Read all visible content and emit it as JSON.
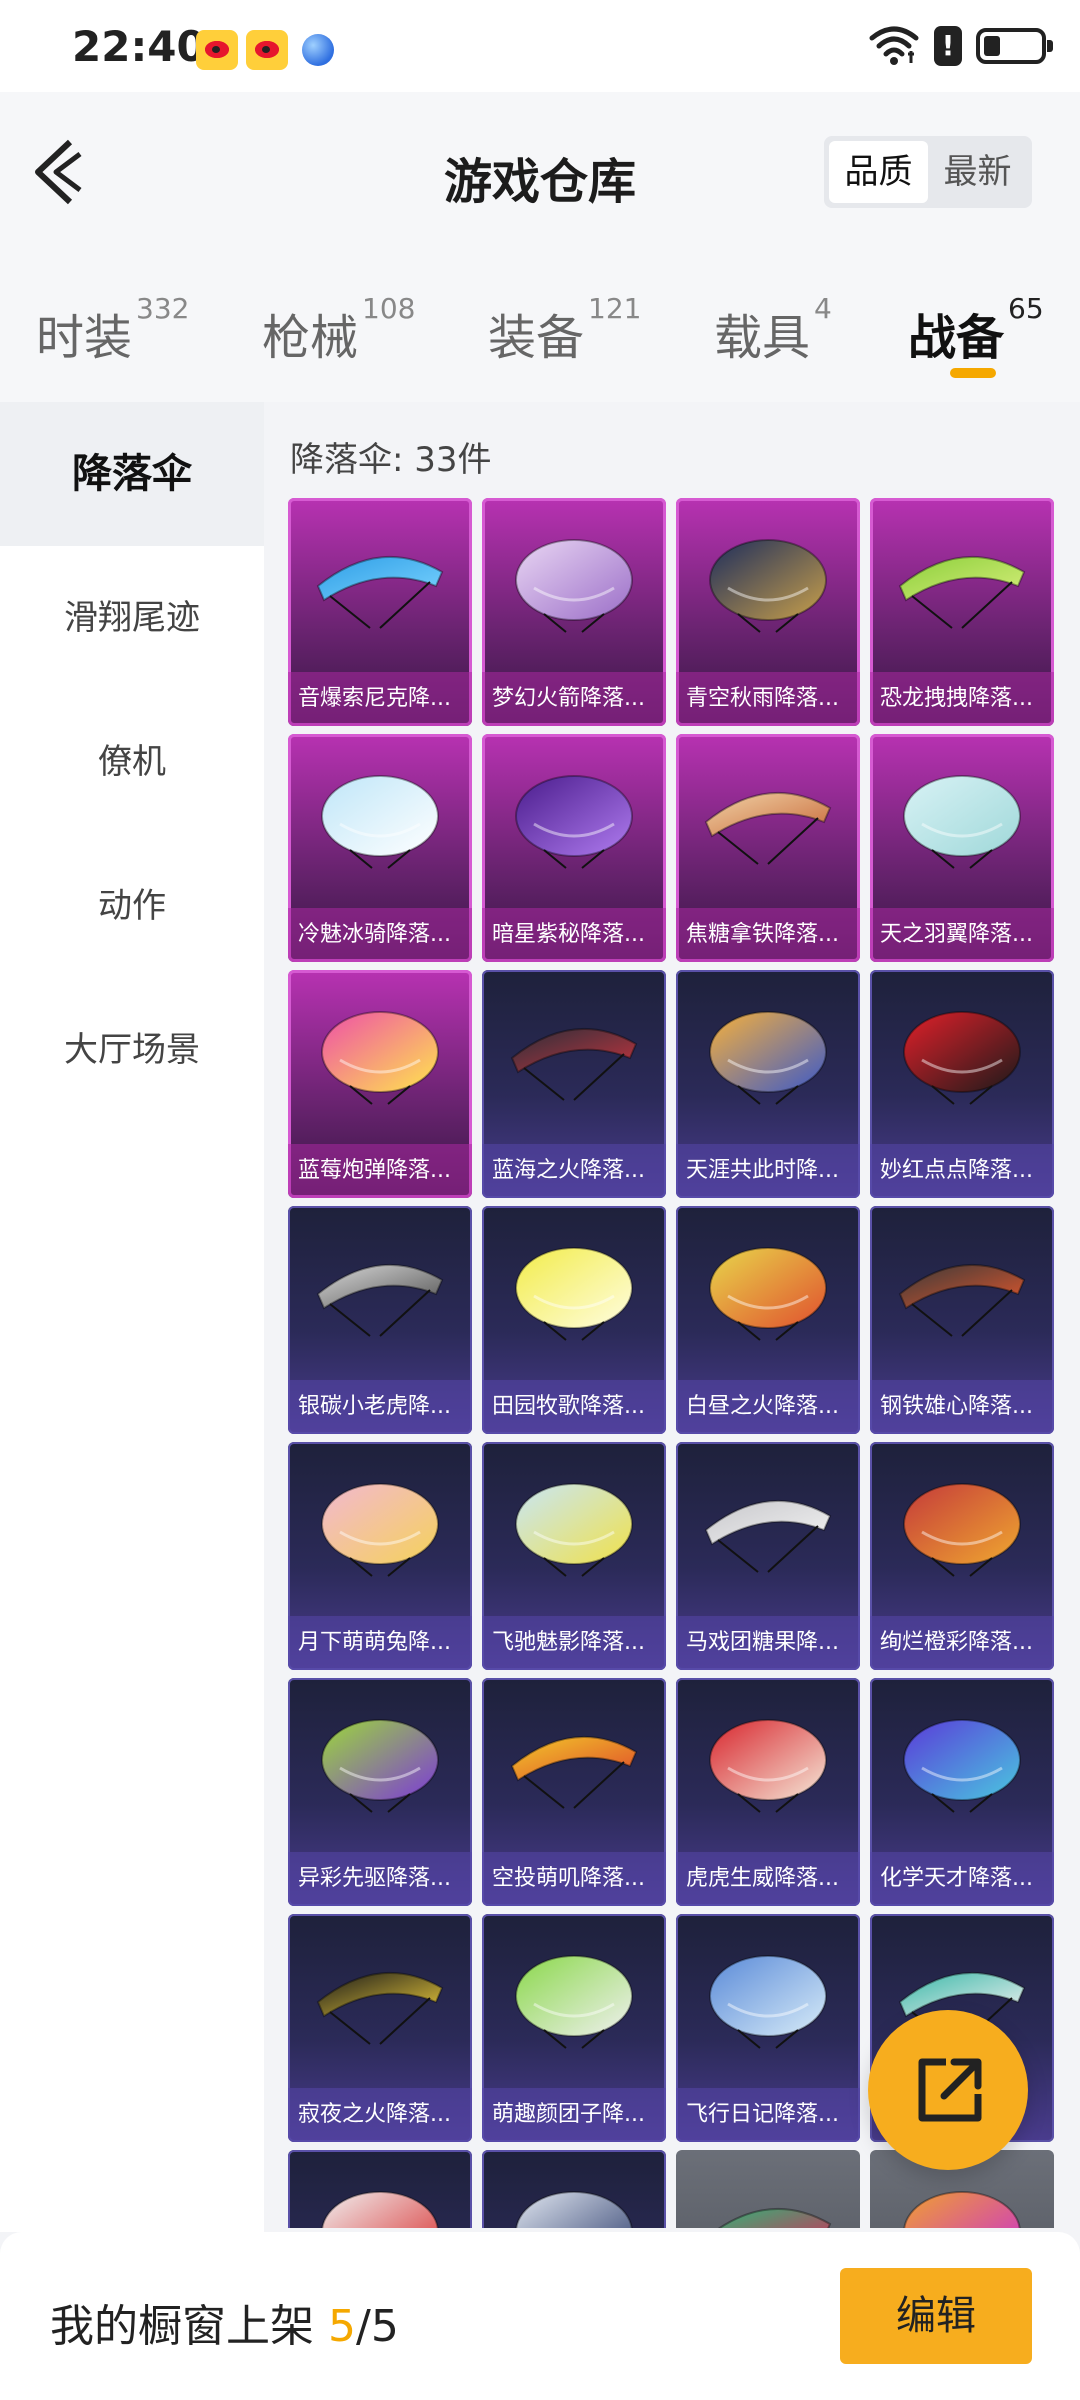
{
  "status_bar": {
    "time": "22:40",
    "notifications": [
      "weibo-icon",
      "weibo-icon",
      "planet-icon"
    ],
    "indicators": [
      "wifi-icon",
      "alert-icon",
      "battery-icon"
    ]
  },
  "header": {
    "title": "游戏仓库",
    "sort_options": [
      {
        "label": "品质",
        "active": true
      },
      {
        "label": "最新",
        "active": false
      }
    ]
  },
  "tabs": [
    {
      "label": "时装",
      "count": "332",
      "active": false
    },
    {
      "label": "枪械",
      "count": "108",
      "active": false
    },
    {
      "label": "装备",
      "count": "121",
      "active": false
    },
    {
      "label": "载具",
      "count": "4",
      "active": false
    },
    {
      "label": "战备",
      "count": "65",
      "active": true
    }
  ],
  "categories": [
    {
      "label": "降落伞",
      "active": true
    },
    {
      "label": "滑翔尾迹",
      "active": false
    },
    {
      "label": "僚机",
      "active": false
    },
    {
      "label": "动作",
      "active": false
    },
    {
      "label": "大厅场景",
      "active": false
    }
  ],
  "grid_title": "降落伞: 33件",
  "items": [
    {
      "label": "音爆索尼克降...",
      "tier": "purple",
      "colors": [
        "#2f9ee6",
        "#7ad3ff"
      ]
    },
    {
      "label": "梦幻火箭降落...",
      "tier": "purple",
      "colors": [
        "#e9d6f3",
        "#9b6ec8"
      ]
    },
    {
      "label": "青空秋雨降落...",
      "tier": "purple",
      "colors": [
        "#1d2d5c",
        "#c9a04a"
      ]
    },
    {
      "label": "恐龙拽拽降落...",
      "tier": "purple",
      "colors": [
        "#8ccf3c",
        "#d6ee7a"
      ]
    },
    {
      "label": "冷魅冰骑降落...",
      "tier": "purple",
      "colors": [
        "#bfe6f8",
        "#ffffff"
      ]
    },
    {
      "label": "暗星紫秘降落...",
      "tier": "purple",
      "colors": [
        "#4a1c8c",
        "#b07cf0"
      ]
    },
    {
      "label": "焦糖拿铁降落...",
      "tier": "purple",
      "colors": [
        "#f0d2a6",
        "#c96a3a"
      ]
    },
    {
      "label": "天之羽翼降落...",
      "tier": "purple",
      "colors": [
        "#d8f2f5",
        "#9fd8d9"
      ]
    },
    {
      "label": "蓝莓炮弹降落...",
      "tier": "purple",
      "colors": [
        "#ee4fa8",
        "#ffe64d"
      ]
    },
    {
      "label": "蓝海之火降落...",
      "tier": "blue",
      "colors": [
        "#2b2f3a",
        "#c2343e"
      ]
    },
    {
      "label": "天涯共此时降...",
      "tier": "blue",
      "colors": [
        "#f7b13b",
        "#3b59c9"
      ]
    },
    {
      "label": "妙红点点降落...",
      "tier": "blue",
      "colors": [
        "#e2202a",
        "#1a1a1a"
      ]
    },
    {
      "label": "银碳小老虎降...",
      "tier": "blue",
      "colors": [
        "#d8d8d8",
        "#555555"
      ]
    },
    {
      "label": "田园牧歌降落...",
      "tier": "blue",
      "colors": [
        "#f2ec4a",
        "#fffde0"
      ]
    },
    {
      "label": "白昼之火降落...",
      "tier": "blue",
      "colors": [
        "#e8d64b",
        "#e0502e"
      ]
    },
    {
      "label": "钢铁雄心降落...",
      "tier": "blue",
      "colors": [
        "#3a3a3a",
        "#e0562c"
      ]
    },
    {
      "label": "月下萌萌兔降...",
      "tier": "blue",
      "colors": [
        "#f2b8d0",
        "#f5d25a"
      ]
    },
    {
      "label": "飞驰魅影降落...",
      "tier": "blue",
      "colors": [
        "#c8e6f5",
        "#f0e14a"
      ]
    },
    {
      "label": "马戏团糖果降...",
      "tier": "blue",
      "colors": [
        "#c8c8cc",
        "#f2f2f2"
      ]
    },
    {
      "label": "绚烂橙彩降落...",
      "tier": "blue",
      "colors": [
        "#c43a3a",
        "#f0a830"
      ]
    },
    {
      "label": "异彩先驱降落...",
      "tier": "blue",
      "colors": [
        "#9cd83a",
        "#7c3ad8"
      ]
    },
    {
      "label": "空投萌叽降落...",
      "tier": "blue",
      "colors": [
        "#f2c72a",
        "#e04d2a"
      ]
    },
    {
      "label": "虎虎生威降落...",
      "tier": "blue",
      "colors": [
        "#d8262e",
        "#f5e8d8"
      ]
    },
    {
      "label": "化学天才降落...",
      "tier": "blue",
      "colors": [
        "#5a3ad8",
        "#4ac8e0"
      ]
    },
    {
      "label": "寂夜之火降落...",
      "tier": "blue",
      "colors": [
        "#1a1a1a",
        "#e8c83a"
      ]
    },
    {
      "label": "萌趣颜团子降...",
      "tier": "blue",
      "colors": [
        "#8ad84a",
        "#f0f0f0"
      ]
    },
    {
      "label": "飞行日记降落...",
      "tier": "blue",
      "colors": [
        "#5a8ad8",
        "#d8ecf8"
      ]
    },
    {
      "label": "",
      "tier": "blue",
      "colors": [
        "#3ab8a8",
        "#f0f0f0"
      ]
    },
    {
      "label": "",
      "tier": "blue",
      "colors": [
        "#f0f0f0",
        "#d82a2a"
      ]
    },
    {
      "label": "",
      "tier": "blue",
      "colors": [
        "#e0e6f0",
        "#2a3a6a"
      ]
    },
    {
      "label": "",
      "tier": "grey",
      "colors": [
        "#2ab878",
        "#d82a5a"
      ]
    },
    {
      "label": "",
      "tier": "grey",
      "colors": [
        "#f0a030",
        "#c82ad8"
      ]
    }
  ],
  "share_button": {
    "icon": "share-icon"
  },
  "bottom_bar": {
    "showcase_label": "我的橱窗上架",
    "showcase_current": "5",
    "showcase_total": "/5",
    "edit_label": "编辑"
  }
}
